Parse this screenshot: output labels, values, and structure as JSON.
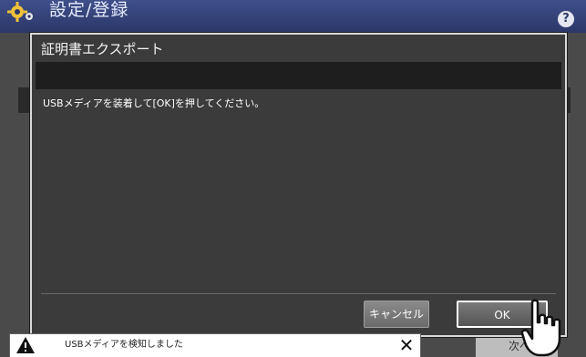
{
  "header": {
    "title": "設定/登録",
    "help_label": "?"
  },
  "background": {
    "next_button_label": "次へ"
  },
  "dialog": {
    "title": "証明書エクスポート",
    "message": "USBメディアを装着して[OK]を押してください。",
    "cancel_label": "キャンセル",
    "ok_label": "OK"
  },
  "notification": {
    "text": "USBメディアを検知しました",
    "close_label": "✕"
  }
}
